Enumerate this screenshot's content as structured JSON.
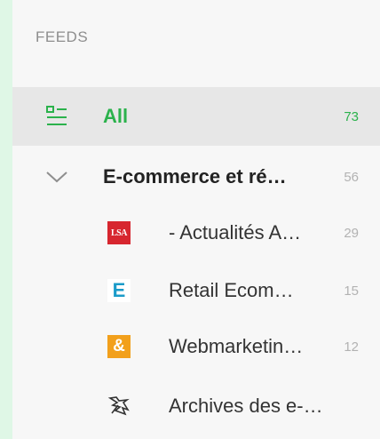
{
  "section_title": "FEEDS",
  "all": {
    "label": "All",
    "count": "73",
    "icon": "list-icon",
    "accent": "#2bb24c"
  },
  "category": {
    "label": "E-commerce et ré…",
    "count": "56",
    "icon": "chevron-down-icon"
  },
  "feeds": [
    {
      "label": "- Actualités A…",
      "count": "29",
      "icon": "lsa-favicon",
      "icon_text": "LSA"
    },
    {
      "label": "Retail Ecom…",
      "count": "15",
      "icon": "e-favicon",
      "icon_text": "E"
    },
    {
      "label": "Webmarketin…",
      "count": "12",
      "icon": "ampersand-favicon",
      "icon_text": "&"
    },
    {
      "label": "Archives des e-…",
      "count": "",
      "icon": "archives-favicon"
    }
  ]
}
